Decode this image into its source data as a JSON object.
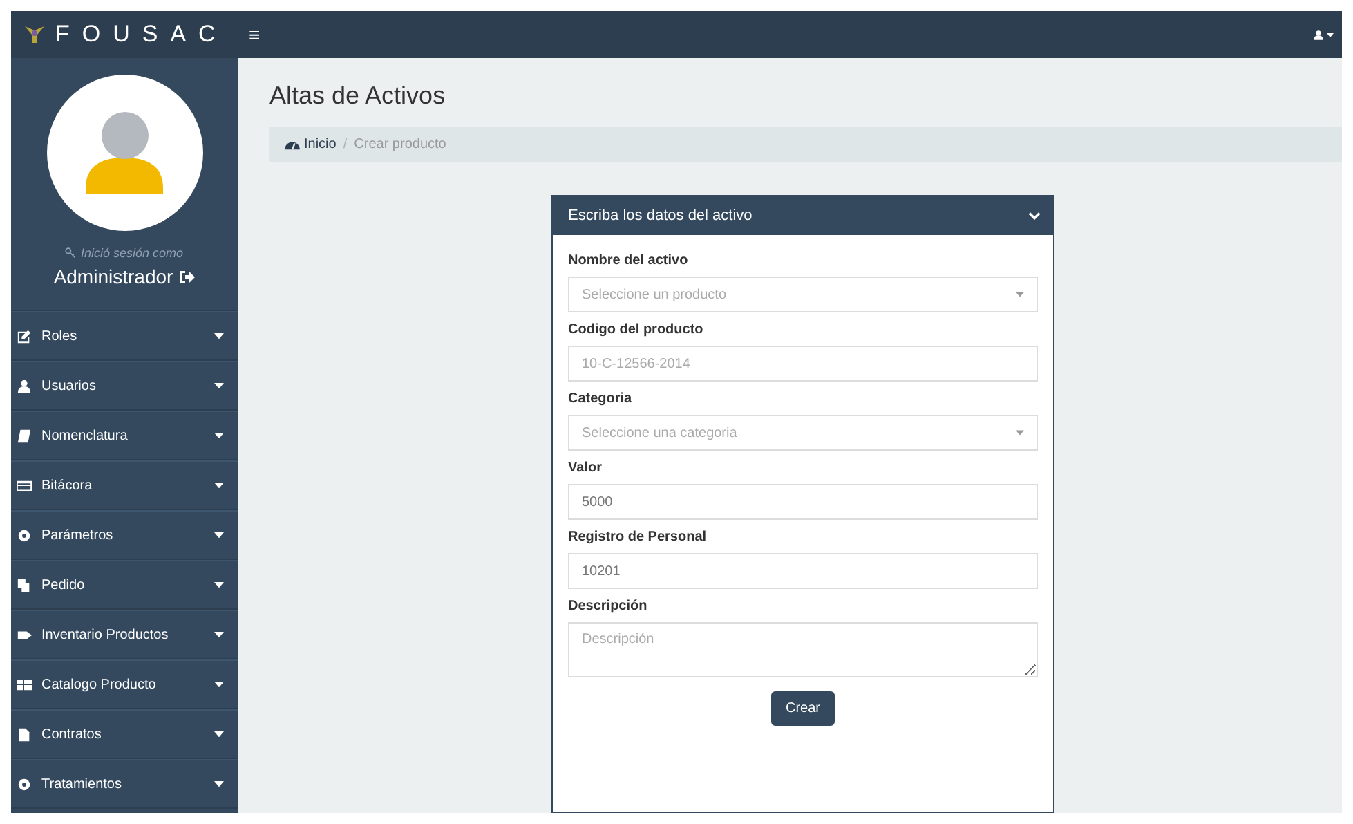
{
  "brand": {
    "title": "FOUSAC"
  },
  "topbar": {
    "menu_glyph": "≡"
  },
  "profile": {
    "caption": "Inició sesión como",
    "name": "Administrador"
  },
  "sidebar": {
    "items": [
      {
        "label": "Roles"
      },
      {
        "label": "Usuarios"
      },
      {
        "label": "Nomenclatura"
      },
      {
        "label": "Bitácora"
      },
      {
        "label": "Parámetros"
      },
      {
        "label": "Pedido"
      },
      {
        "label": "Inventario Productos"
      },
      {
        "label": "Catalogo Producto"
      },
      {
        "label": "Contratos"
      },
      {
        "label": "Tratamientos"
      }
    ]
  },
  "page": {
    "title": "Altas de Activos"
  },
  "breadcrumb": {
    "separator": "/",
    "items": [
      {
        "label": "Inicio",
        "kind": "link"
      },
      {
        "label": "Crear producto",
        "kind": "current"
      }
    ]
  },
  "panel": {
    "title": "Escriba los datos del activo",
    "fields": [
      {
        "label": "Nombre del activo",
        "kind": "select",
        "placeholder": "Seleccione un producto"
      },
      {
        "label": "Codigo del producto",
        "kind": "input",
        "placeholder": "10-C-12566-2014"
      },
      {
        "label": "Categoria",
        "kind": "select",
        "placeholder": "Seleccione una categoria"
      },
      {
        "label": "Valor",
        "kind": "input",
        "value": "5000"
      },
      {
        "label": "Registro de Personal",
        "kind": "input",
        "value": "10201"
      },
      {
        "label": "Descripción",
        "kind": "textarea",
        "placeholder": "Descripción"
      }
    ],
    "submit": "Crear"
  }
}
